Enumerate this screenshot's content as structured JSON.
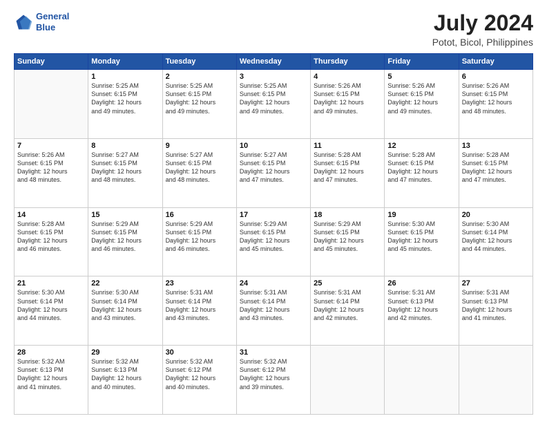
{
  "logo": {
    "line1": "General",
    "line2": "Blue"
  },
  "title": "July 2024",
  "subtitle": "Potot, Bicol, Philippines",
  "weekdays": [
    "Sunday",
    "Monday",
    "Tuesday",
    "Wednesday",
    "Thursday",
    "Friday",
    "Saturday"
  ],
  "weeks": [
    [
      {
        "day": "",
        "info": ""
      },
      {
        "day": "1",
        "info": "Sunrise: 5:25 AM\nSunset: 6:15 PM\nDaylight: 12 hours\nand 49 minutes."
      },
      {
        "day": "2",
        "info": "Sunrise: 5:25 AM\nSunset: 6:15 PM\nDaylight: 12 hours\nand 49 minutes."
      },
      {
        "day": "3",
        "info": "Sunrise: 5:25 AM\nSunset: 6:15 PM\nDaylight: 12 hours\nand 49 minutes."
      },
      {
        "day": "4",
        "info": "Sunrise: 5:26 AM\nSunset: 6:15 PM\nDaylight: 12 hours\nand 49 minutes."
      },
      {
        "day": "5",
        "info": "Sunrise: 5:26 AM\nSunset: 6:15 PM\nDaylight: 12 hours\nand 49 minutes."
      },
      {
        "day": "6",
        "info": "Sunrise: 5:26 AM\nSunset: 6:15 PM\nDaylight: 12 hours\nand 48 minutes."
      }
    ],
    [
      {
        "day": "7",
        "info": "Sunrise: 5:26 AM\nSunset: 6:15 PM\nDaylight: 12 hours\nand 48 minutes."
      },
      {
        "day": "8",
        "info": "Sunrise: 5:27 AM\nSunset: 6:15 PM\nDaylight: 12 hours\nand 48 minutes."
      },
      {
        "day": "9",
        "info": "Sunrise: 5:27 AM\nSunset: 6:15 PM\nDaylight: 12 hours\nand 48 minutes."
      },
      {
        "day": "10",
        "info": "Sunrise: 5:27 AM\nSunset: 6:15 PM\nDaylight: 12 hours\nand 47 minutes."
      },
      {
        "day": "11",
        "info": "Sunrise: 5:28 AM\nSunset: 6:15 PM\nDaylight: 12 hours\nand 47 minutes."
      },
      {
        "day": "12",
        "info": "Sunrise: 5:28 AM\nSunset: 6:15 PM\nDaylight: 12 hours\nand 47 minutes."
      },
      {
        "day": "13",
        "info": "Sunrise: 5:28 AM\nSunset: 6:15 PM\nDaylight: 12 hours\nand 47 minutes."
      }
    ],
    [
      {
        "day": "14",
        "info": "Sunrise: 5:28 AM\nSunset: 6:15 PM\nDaylight: 12 hours\nand 46 minutes."
      },
      {
        "day": "15",
        "info": "Sunrise: 5:29 AM\nSunset: 6:15 PM\nDaylight: 12 hours\nand 46 minutes."
      },
      {
        "day": "16",
        "info": "Sunrise: 5:29 AM\nSunset: 6:15 PM\nDaylight: 12 hours\nand 46 minutes."
      },
      {
        "day": "17",
        "info": "Sunrise: 5:29 AM\nSunset: 6:15 PM\nDaylight: 12 hours\nand 45 minutes."
      },
      {
        "day": "18",
        "info": "Sunrise: 5:29 AM\nSunset: 6:15 PM\nDaylight: 12 hours\nand 45 minutes."
      },
      {
        "day": "19",
        "info": "Sunrise: 5:30 AM\nSunset: 6:15 PM\nDaylight: 12 hours\nand 45 minutes."
      },
      {
        "day": "20",
        "info": "Sunrise: 5:30 AM\nSunset: 6:14 PM\nDaylight: 12 hours\nand 44 minutes."
      }
    ],
    [
      {
        "day": "21",
        "info": "Sunrise: 5:30 AM\nSunset: 6:14 PM\nDaylight: 12 hours\nand 44 minutes."
      },
      {
        "day": "22",
        "info": "Sunrise: 5:30 AM\nSunset: 6:14 PM\nDaylight: 12 hours\nand 43 minutes."
      },
      {
        "day": "23",
        "info": "Sunrise: 5:31 AM\nSunset: 6:14 PM\nDaylight: 12 hours\nand 43 minutes."
      },
      {
        "day": "24",
        "info": "Sunrise: 5:31 AM\nSunset: 6:14 PM\nDaylight: 12 hours\nand 43 minutes."
      },
      {
        "day": "25",
        "info": "Sunrise: 5:31 AM\nSunset: 6:14 PM\nDaylight: 12 hours\nand 42 minutes."
      },
      {
        "day": "26",
        "info": "Sunrise: 5:31 AM\nSunset: 6:13 PM\nDaylight: 12 hours\nand 42 minutes."
      },
      {
        "day": "27",
        "info": "Sunrise: 5:31 AM\nSunset: 6:13 PM\nDaylight: 12 hours\nand 41 minutes."
      }
    ],
    [
      {
        "day": "28",
        "info": "Sunrise: 5:32 AM\nSunset: 6:13 PM\nDaylight: 12 hours\nand 41 minutes."
      },
      {
        "day": "29",
        "info": "Sunrise: 5:32 AM\nSunset: 6:13 PM\nDaylight: 12 hours\nand 40 minutes."
      },
      {
        "day": "30",
        "info": "Sunrise: 5:32 AM\nSunset: 6:12 PM\nDaylight: 12 hours\nand 40 minutes."
      },
      {
        "day": "31",
        "info": "Sunrise: 5:32 AM\nSunset: 6:12 PM\nDaylight: 12 hours\nand 39 minutes."
      },
      {
        "day": "",
        "info": ""
      },
      {
        "day": "",
        "info": ""
      },
      {
        "day": "",
        "info": ""
      }
    ]
  ]
}
